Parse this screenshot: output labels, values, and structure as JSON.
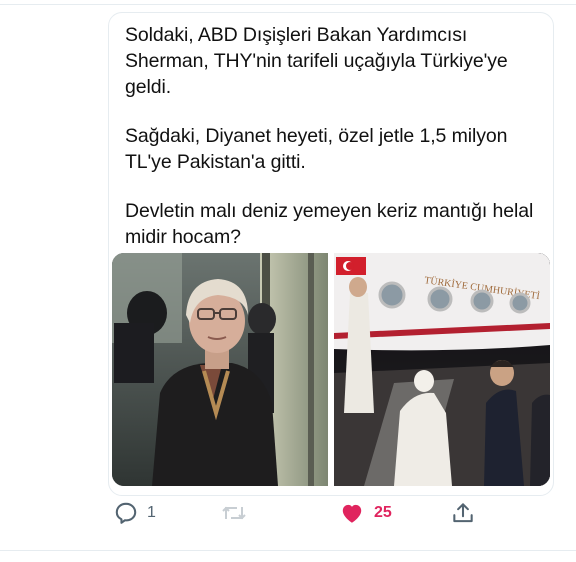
{
  "tweet": {
    "paragraphs": [
      "Soldaki, ABD Dışişleri Bakan Yardımcısı Sherman, THY'nin tarifeli uçağıyla Türkiye'ye geldi.",
      "Sağdaki, Diyanet heyeti, özel jetle 1,5 milyon TL'ye Pakistan'a gitti.",
      "Devletin malı deniz yemeyen keriz mantığı helal midir hocam?"
    ],
    "media": {
      "left_photo": "woman-in-dark-coat-at-airport",
      "right_photo": "delegation-boarding-private-jet",
      "aircraft_lettering": "TÜRKİYE CUMHURİYETİ"
    }
  },
  "actions": {
    "reply_count": "1",
    "retweet_count": "",
    "like_count": "25",
    "liked": true,
    "icons": [
      "comment-icon",
      "retweet-icon",
      "heart-icon",
      "share-icon"
    ]
  },
  "colors": {
    "like": "#e0245e",
    "icon": "#536471",
    "border": "#e6ecf0"
  }
}
